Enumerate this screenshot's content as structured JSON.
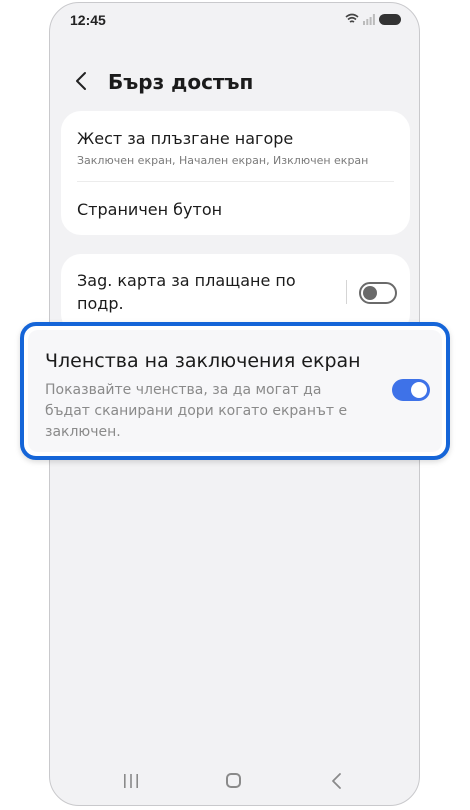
{
  "status_bar": {
    "time": "12:45"
  },
  "header": {
    "title": "Бърз достъп",
    "back_icon": "chevron-left-icon"
  },
  "settings": {
    "swipe_up": {
      "title": "Жест за плъзгане нагоре",
      "subtitle": "Заключен екран, Начален екран, Изключен екран"
    },
    "side_button": {
      "title": "Страничен бутон"
    },
    "default_card": {
      "title_line1": "Заg. карта за плащане по",
      "title_line2": "подр.",
      "enabled": false
    }
  },
  "highlight": {
    "title": "Членства на заключения екран",
    "description": "Показвайте членства, за да могат да бъдат сканирани дори когато екранът е заключен.",
    "enabled": true,
    "border_color": "#1565d8"
  },
  "colors": {
    "accent": "#3e72e8",
    "background": "#f2f2f4"
  },
  "nav": {
    "recents_icon": "recents-icon",
    "home_icon": "home-icon",
    "back_icon": "back-icon"
  }
}
